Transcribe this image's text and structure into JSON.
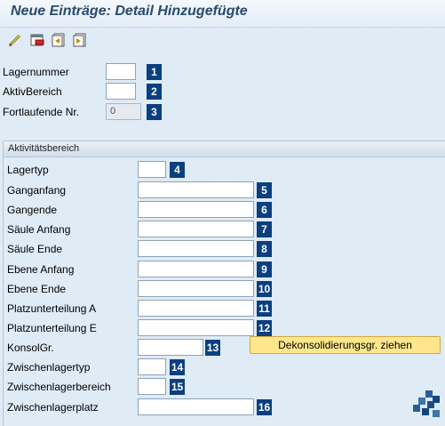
{
  "window": {
    "title": "Neue Einträge: Detail Hinzugefügte"
  },
  "toolbar": {
    "icons": [
      "edit-pen-icon",
      "delete-icon",
      "previous-entry-icon",
      "next-entry-icon"
    ]
  },
  "header_fields": [
    {
      "label": "Lagernummer",
      "value": "",
      "badge": "1"
    },
    {
      "label": "AktivBereich",
      "value": "",
      "badge": "2"
    },
    {
      "label": "Fortlaufende Nr.",
      "value": "0",
      "badge": "3"
    }
  ],
  "group": {
    "title": "Aktivitätsbereich",
    "fields": [
      {
        "label": "Lagertyp",
        "value": "",
        "badge": "4"
      },
      {
        "label": "Ganganfang",
        "value": "",
        "badge": "5"
      },
      {
        "label": "Gangende",
        "value": "",
        "badge": "6"
      },
      {
        "label": "Säule Anfang",
        "value": "",
        "badge": "7"
      },
      {
        "label": "Säule Ende",
        "value": "",
        "badge": "8"
      },
      {
        "label": "Ebene Anfang",
        "value": "",
        "badge": "9"
      },
      {
        "label": "Ebene Ende",
        "value": "",
        "badge": "10"
      },
      {
        "label": "Platzunterteilung A",
        "value": "",
        "badge": "11"
      },
      {
        "label": "Platzunterteilung E",
        "value": "",
        "badge": "12"
      },
      {
        "label": "KonsolGr.",
        "value": "",
        "badge": "13"
      },
      {
        "label": "Zwischenlagertyp",
        "value": "",
        "badge": "14"
      },
      {
        "label": "Zwischenlagerbereich",
        "value": "",
        "badge": "15"
      },
      {
        "label": "Zwischenlagerplatz",
        "value": "",
        "badge": "16"
      }
    ],
    "action_button": "Dekonsolidierungsgr. ziehen"
  },
  "colors": {
    "badge": "#0b3f80",
    "title": "#284a6f",
    "action": "#fde68b"
  }
}
